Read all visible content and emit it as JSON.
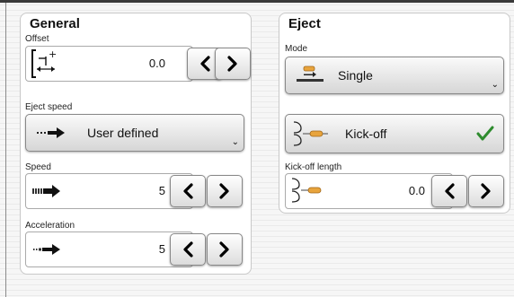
{
  "general": {
    "title": "General",
    "offset": {
      "label": "Offset",
      "value": "0.0"
    },
    "eject_speed": {
      "label": "Eject speed",
      "value": "User defined"
    },
    "speed": {
      "label": "Speed",
      "value": "5"
    },
    "acceleration": {
      "label": "Acceleration",
      "value": "5"
    }
  },
  "eject": {
    "title": "Eject",
    "mode": {
      "label": "Mode",
      "value": "Single"
    },
    "kickoff": {
      "label": "Kick-off",
      "checked": true
    },
    "kickoff_length": {
      "label": "Kick-off length",
      "value": "0.0"
    }
  },
  "colors": {
    "check": "#2e8b2e",
    "accent_orange": "#e8a43c"
  }
}
